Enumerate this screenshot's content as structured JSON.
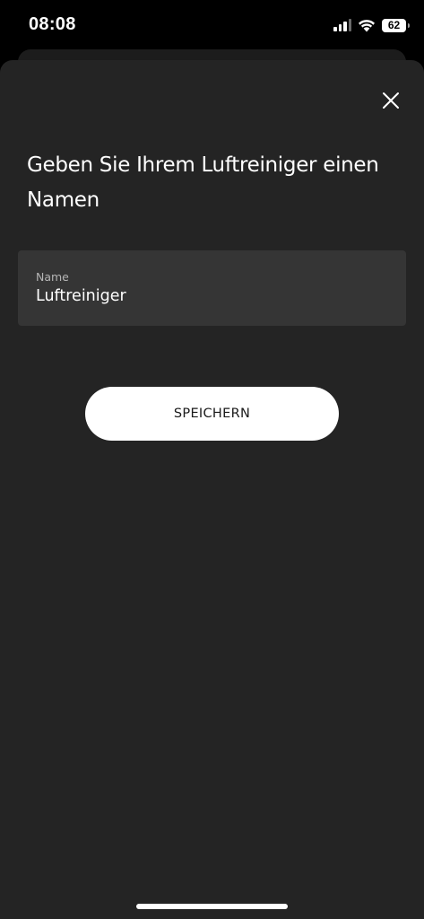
{
  "status_bar": {
    "time": "08:08",
    "battery": "62",
    "icons": [
      "signal-icon",
      "wifi-icon",
      "battery-icon"
    ]
  },
  "dialog": {
    "title": "Geben Sie Ihrem Luftreiniger einen Namen",
    "close_icon": "close-icon",
    "name_field": {
      "label": "Name",
      "value": "Luftreiniger"
    },
    "save_label": "SPEICHERN"
  },
  "colors": {
    "background": "#000000",
    "sheet": "#242424",
    "field": "#353535",
    "button": "#ffffff",
    "button_text": "#1a1a1a"
  }
}
